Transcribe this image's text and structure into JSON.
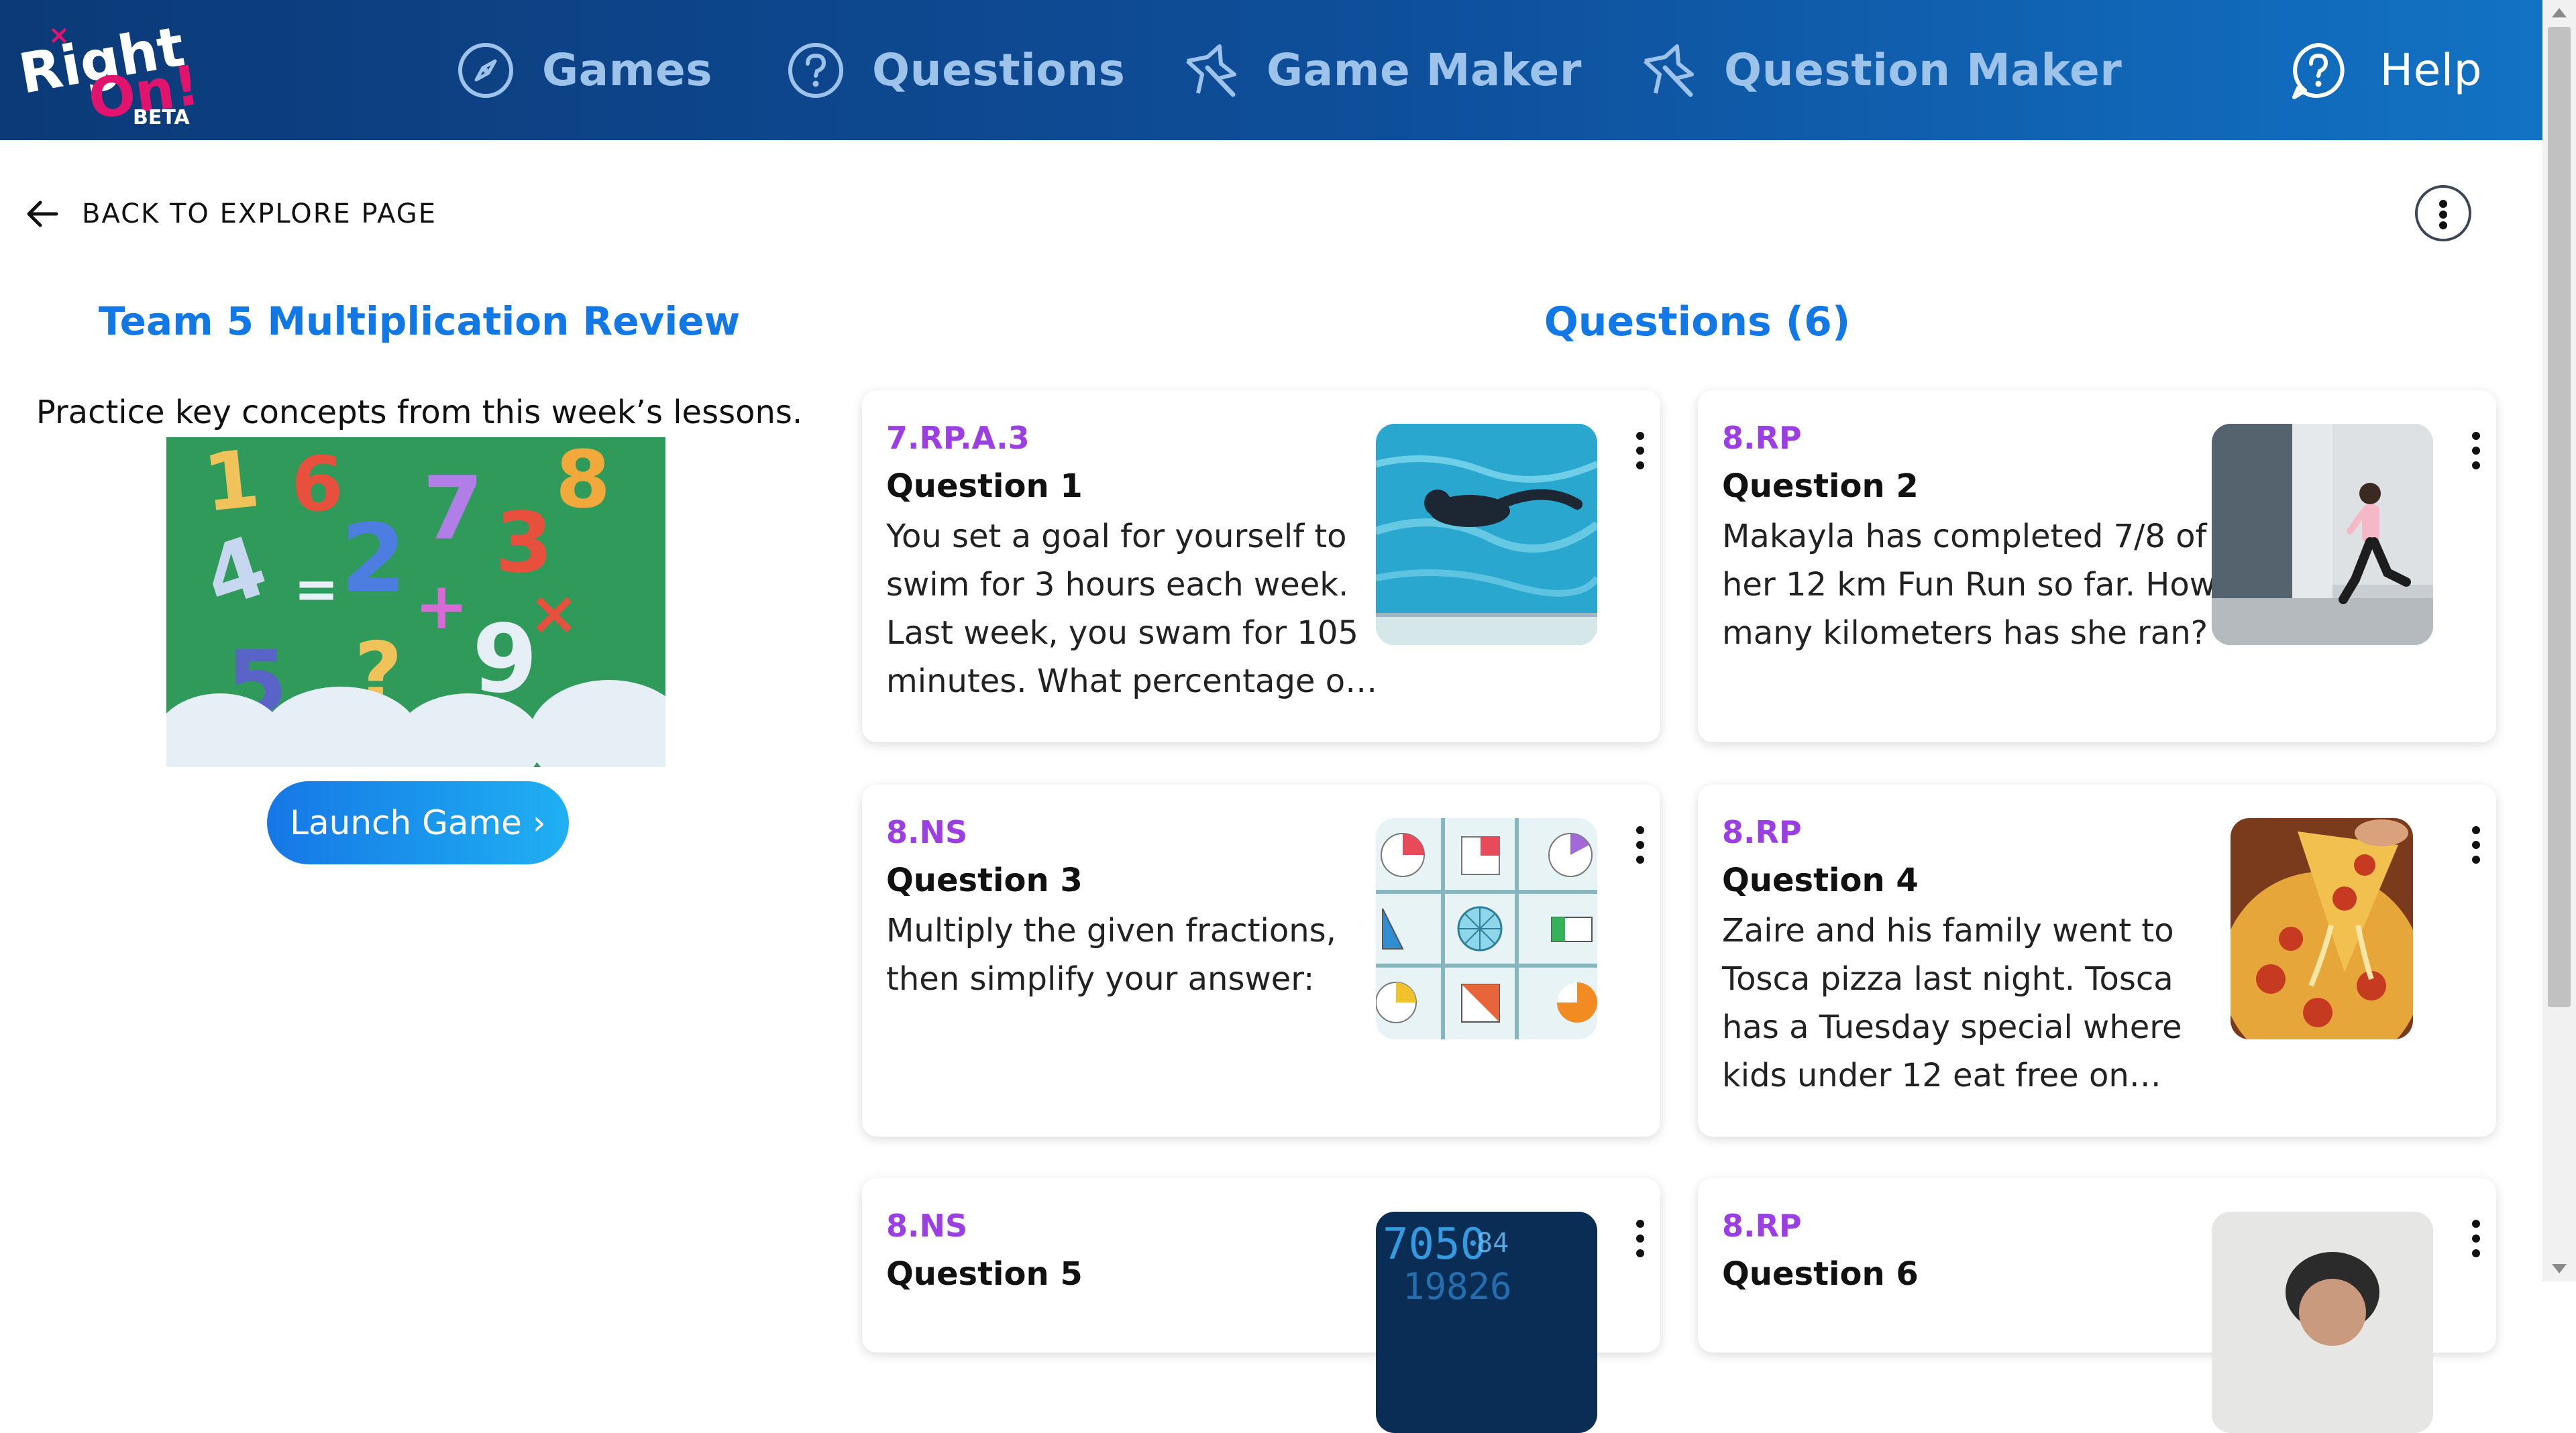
{
  "nav": {
    "logo_text_1": "Right",
    "logo_text_2": "On!",
    "logo_beta": "BETA",
    "items": [
      {
        "label": "Games",
        "icon": "compass-icon"
      },
      {
        "label": "Questions",
        "icon": "question-circle-icon"
      },
      {
        "label": "Game Maker",
        "icon": "star-pencil-icon"
      },
      {
        "label": "Question Maker",
        "icon": "star-pencil-icon"
      }
    ],
    "help_label": "Help"
  },
  "back_link": "BACK TO EXPLORE PAGE",
  "game": {
    "title": "Team 5 Multiplication Review",
    "description": "Practice key concepts from this week’s lessons.",
    "launch_label": "Launch Game ›"
  },
  "questions_heading": "Questions (6)",
  "questions": [
    {
      "standard": "7.RP.A.3",
      "title": "Question 1",
      "text": "You set a goal for yourself to swim for 3 hours each week. Last week, you swam for 105 minutes. What percentage o…",
      "image": "swimmer"
    },
    {
      "standard": "8.RP",
      "title": "Question 2",
      "text": "Makayla has completed 7/8 of her 12 km Fun Run so far. How many kilometers has she ran?",
      "image": "runner"
    },
    {
      "standard": "8.NS",
      "title": "Question 3",
      "text": "Multiply the given fractions, then simplify your answer:",
      "image": "fraction-grid"
    },
    {
      "standard": "8.RP",
      "title": "Question 4",
      "text": "Zaire and his family went to Tosca pizza last night. Tosca has a Tuesday special where kids under 12 eat free on…",
      "image": "pizza"
    },
    {
      "standard": "8.NS",
      "title": "Question 5",
      "text": "",
      "image": "digital-numbers"
    },
    {
      "standard": "8.RP",
      "title": "Question 6",
      "text": "",
      "image": "person"
    }
  ],
  "colors": {
    "brand_blue": "#1178e6",
    "standard_purple": "#9b3fe3",
    "nav_bg": "#0e4f9b",
    "logo_pink": "#e0146c"
  }
}
